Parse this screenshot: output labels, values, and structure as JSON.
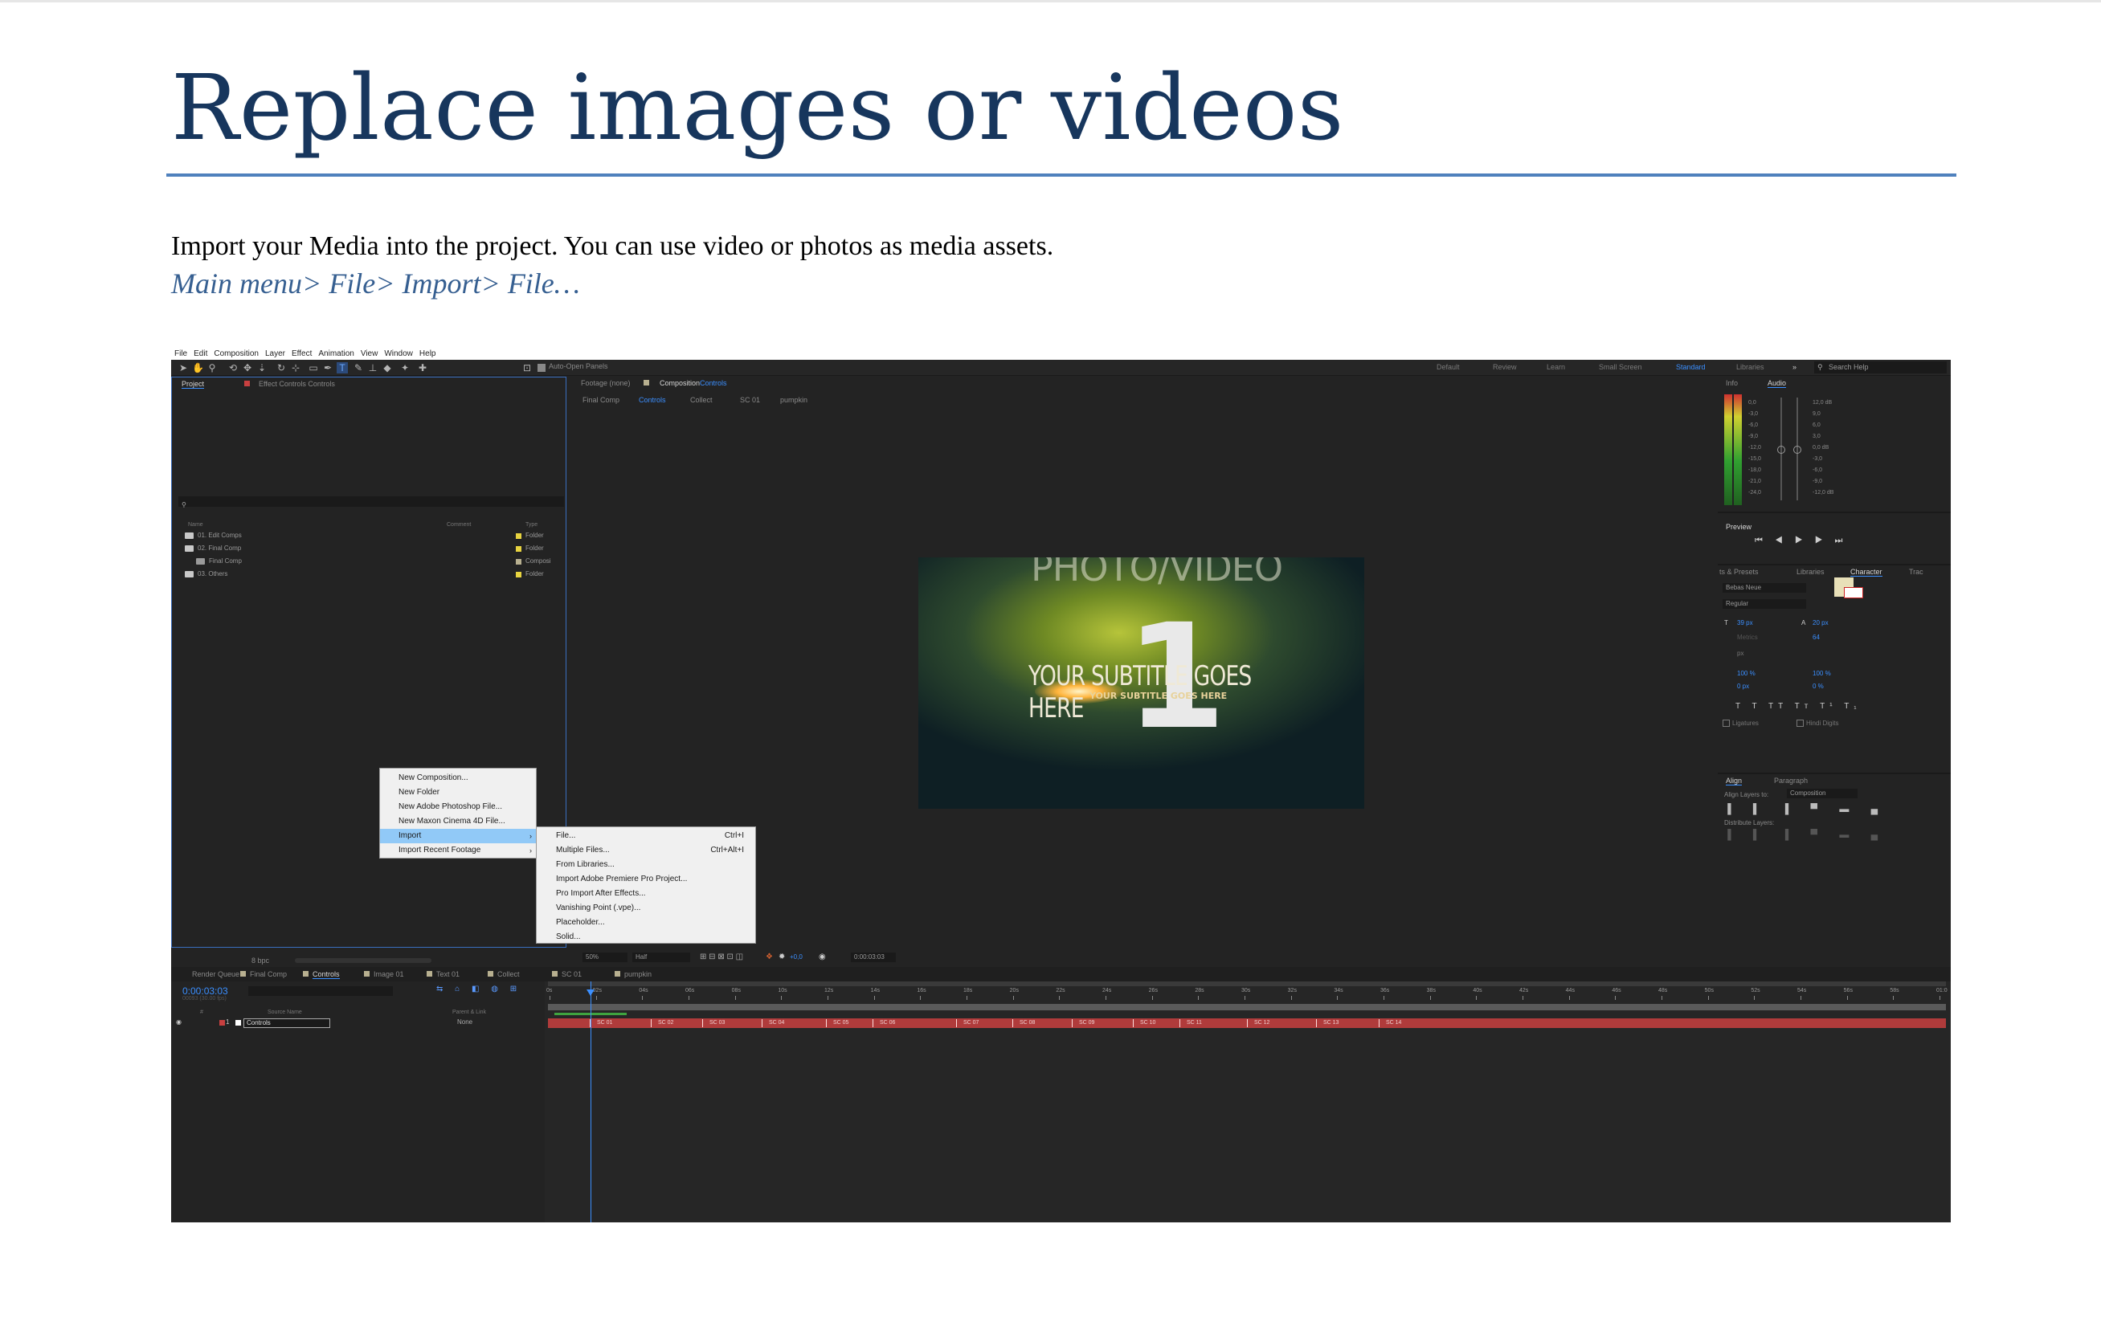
{
  "doc": {
    "title": "Replace images or videos",
    "body": "Import your Media into the project. You can use video or photos as media assets.",
    "path": "Main menu> File> Import> File…"
  },
  "ae": {
    "menubar": [
      "File",
      "Edit",
      "Composition",
      "Layer",
      "Effect",
      "Animation",
      "View",
      "Window",
      "Help"
    ],
    "auto_open": "Auto-Open Panels",
    "workspaces": [
      "Default",
      "Review",
      "Learn",
      "Small Screen",
      "Standard",
      "Libraries"
    ],
    "search_help": "Search Help",
    "project": {
      "tab_project": "Project",
      "tab_effect": "Effect Controls Controls",
      "columns": {
        "name": "Name",
        "comment": "Comment",
        "type": "Type"
      },
      "rows": [
        {
          "name": "01. Edit Comps",
          "type": "Folder"
        },
        {
          "name": "02. Final Comp",
          "type": "Folder"
        },
        {
          "name": "Final Comp",
          "type": "Composi"
        },
        {
          "name": "03. Others",
          "type": "Folder"
        }
      ],
      "bpc": "8 bpc"
    },
    "comp": {
      "tab_footage": "Footage (none)",
      "tab_composition": "Composition",
      "tab_composition_name": "Controls",
      "flow": [
        "Final Comp",
        "Controls",
        "Collect",
        "SC 01",
        "pumpkin"
      ],
      "ghost_text": "PHOTO/VIDEO",
      "big_number": "1",
      "subtitle": "YOUR SUBTITLE GOES HERE",
      "subtitle_small": "YOUR SUBTITLE GOES HERE",
      "zoom": "50%",
      "resolution": "Half",
      "exposure": "+0,0",
      "timecode": "0:00:03:03"
    },
    "context_menu": [
      {
        "label": "New Composition..."
      },
      {
        "label": "New Folder"
      },
      {
        "label": "New Adobe Photoshop File..."
      },
      {
        "label": "New Maxon Cinema 4D File..."
      },
      {
        "label": "Import",
        "arrow": "›"
      },
      {
        "label": "Import Recent Footage",
        "arrow": "›"
      }
    ],
    "submenu": [
      {
        "label": "File...",
        "shortcut": "Ctrl+I"
      },
      {
        "label": "Multiple Files...",
        "shortcut": "Ctrl+Alt+I"
      },
      {
        "label": "From Libraries..."
      },
      {
        "label": "Import Adobe Premiere Pro Project..."
      },
      {
        "label": "Pro Import After Effects..."
      },
      {
        "label": "Vanishing Point (.vpe)..."
      },
      {
        "label": "Placeholder..."
      },
      {
        "label": "Solid..."
      }
    ],
    "info_tab": "Info",
    "audio_tab": "Audio",
    "audio_left": [
      "0,0",
      "-3,0",
      "-6,0",
      "-9,0",
      "-12,0",
      "-15,0",
      "-18,0",
      "-21,0",
      "-24,0"
    ],
    "audio_right": [
      "12,0 dB",
      "9,0",
      "6,0",
      "3,0",
      "0,0 dB",
      "-3,0",
      "-6,0",
      "-9,0",
      "-12,0 dB"
    ],
    "preview_tab": "Preview",
    "char_tabs": [
      "ts & Presets",
      "Libraries",
      "Character",
      "Trac"
    ],
    "font_family": "Bebas Neue",
    "font_style": "Regular",
    "size": "39 px",
    "leading": "20 px",
    "kerning": "Metrics",
    "tracking": "64",
    "stroke_unit": "px",
    "vscale": "100 %",
    "hscale": "100 %",
    "baseline": "0 px",
    "tsume": "0 %",
    "ligatures": "Ligatures",
    "hindi": "Hindi Digits",
    "align_tab": "Align",
    "paragraph_tab": "Paragraph",
    "align_to_label": "Align Layers to:",
    "align_to": "Composition",
    "distribute": "Distribute Layers:",
    "timeline": {
      "tabs": [
        "Render Queue",
        "Final Comp",
        "Controls",
        "Image 01",
        "Text 01",
        "Collect",
        "SC 01",
        "pumpkin"
      ],
      "timecode": "0:00:03:03",
      "timecode_sub": "00093 (30.00 fps)",
      "cols": {
        "num": "#",
        "source": "Source Name",
        "parent": "Parent & Link"
      },
      "layer_num": "1",
      "layer_name": "Controls",
      "parent": "None",
      "ruler": [
        "0s",
        "02s",
        "04s",
        "06s",
        "08s",
        "10s",
        "12s",
        "14s",
        "16s",
        "18s",
        "20s",
        "22s",
        "24s",
        "26s",
        "28s",
        "30s",
        "32s",
        "34s",
        "36s",
        "38s",
        "40s",
        "42s",
        "44s",
        "46s",
        "48s",
        "50s",
        "52s",
        "54s",
        "56s",
        "58s",
        "01:0"
      ],
      "markers": [
        "SC 01",
        "SC 02",
        "SC 03",
        "SC 04",
        "SC 05",
        "SC 06",
        "SC 07",
        "SC 08",
        "SC 09",
        "SC 10",
        "SC 11",
        "SC 12",
        "SC 13",
        "SC 14"
      ]
    }
  }
}
